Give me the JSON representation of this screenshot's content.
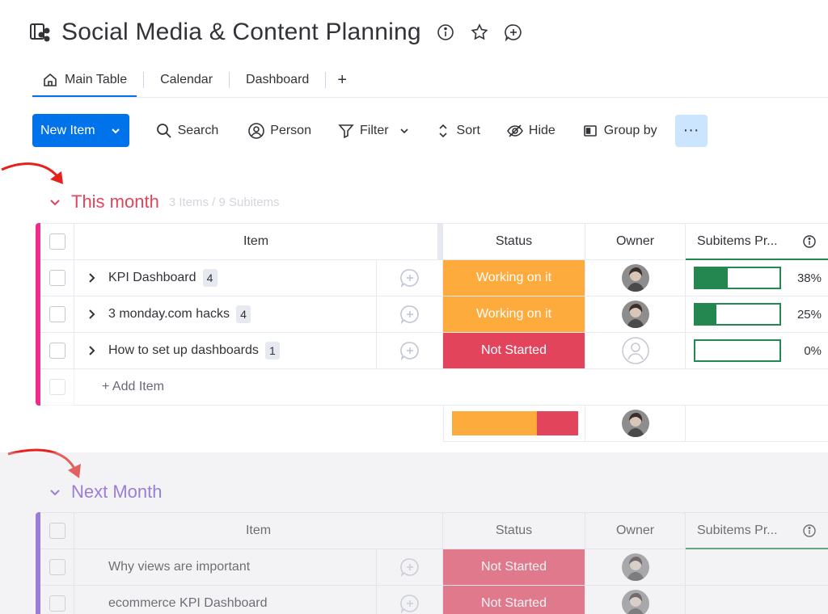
{
  "board": {
    "title": "Social Media & Content Planning"
  },
  "tabs": [
    {
      "label": "Main Table",
      "active": true
    },
    {
      "label": "Calendar",
      "active": false
    },
    {
      "label": "Dashboard",
      "active": false
    },
    {
      "label": "+",
      "active": false
    }
  ],
  "toolbar": {
    "new_item": "New Item",
    "search": "Search",
    "person": "Person",
    "filter": "Filter",
    "sort": "Sort",
    "hide": "Hide",
    "group_by": "Group by",
    "more": "···"
  },
  "colors": {
    "primary": "#0073ea",
    "this_month": "#e2445c",
    "this_month_bar": "#f02b8a",
    "next_month": "#784bd1",
    "working": "#fdab3d",
    "not_started": "#e2445c",
    "progress": "#258750"
  },
  "columns": {
    "item": "Item",
    "status": "Status",
    "owner": "Owner",
    "subitems": "Subitems Pr..."
  },
  "groups": [
    {
      "title": "This month",
      "count": "3 Items / 9 Subitems",
      "add_item": "+ Add Item",
      "rows": [
        {
          "name": "KPI Dashboard",
          "badge": "4",
          "status": "Working on it",
          "owner": "avatar",
          "progress": 0.38,
          "progress_label": "38%"
        },
        {
          "name": "3 monday.com hacks",
          "badge": "4",
          "status": "Working on it",
          "owner": "avatar",
          "progress": 0.25,
          "progress_label": "25%"
        },
        {
          "name": "How to set up dashboards",
          "badge": "1",
          "status": "Not Started",
          "owner": "empty",
          "progress": 0,
          "progress_label": "0%"
        }
      ],
      "summary": {
        "working_share": 0.67,
        "not_started_share": 0.33
      }
    },
    {
      "title": "Next Month",
      "rows": [
        {
          "name": "Why views are important",
          "status": "Not Started",
          "owner": "avatar"
        },
        {
          "name": "ecommerce KPI Dashboard",
          "status": "Not Started",
          "owner": "avatar"
        }
      ]
    }
  ]
}
